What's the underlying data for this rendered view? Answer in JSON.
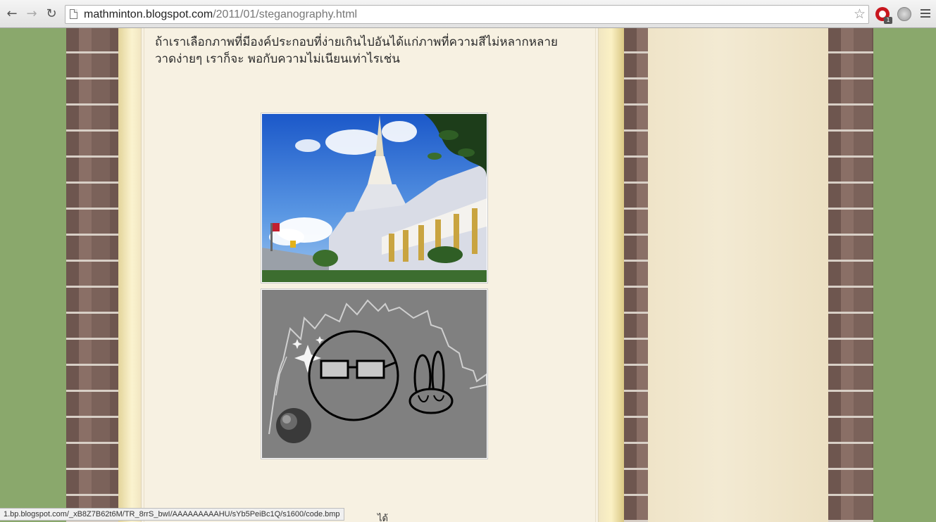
{
  "browser": {
    "url_host": "mathminton.blogspot.com",
    "url_path": "/2011/01/steganography.html",
    "adblock_badge": "1"
  },
  "post": {
    "line1": "ถ้าเราเลือกภาพที่มีองค์ประกอบที่ง่ายเกินไปอันได้แก่ภาพที่ความสีไม่หลากหลาย",
    "line2": "วาดง่ายๆ เราก็จะ พอกับความไม่เนียนเท่าไรเช่น",
    "cut_text": "ได้"
  },
  "status_bar": {
    "link": "1.bp.blogspot.com/_xB8Z7B62t6M/TR_8rrS_bwI/AAAAAAAAAHU/sYb5PeiBc1Q/s1600/code.bmp"
  },
  "icons": {
    "back": "back-arrow-icon",
    "forward": "forward-arrow-icon",
    "reload": "reload-icon",
    "bookmark": "star-icon",
    "menu": "hamburger-menu-icon"
  }
}
